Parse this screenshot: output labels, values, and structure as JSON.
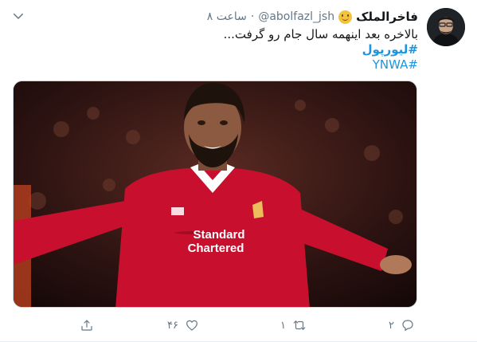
{
  "tweet": {
    "display_name": "فاخرالملک",
    "emoji_icon": "slightly-smiling-face-icon",
    "handle": "@abolfazl_jsh",
    "separator": "·",
    "time": "۸ ساعت",
    "text_line": "بالاخره بعد اینهمه سال جام رو گرفت...",
    "hashtag_1": "#لیورپول",
    "hashtag_2": "#YNWA",
    "media_text": {
      "sponsor_line_1": "Standard",
      "sponsor_line_2": "Chartered"
    }
  },
  "actions": {
    "reply_count": "۲",
    "retweet_count": "۱",
    "like_count": "۴۶",
    "reply_icon": "comment-bubble-icon",
    "retweet_icon": "retweet-icon",
    "like_icon": "heart-icon",
    "share_icon": "share-icon"
  },
  "colors": {
    "link": "#1b95e0",
    "muted": "#657786",
    "jersey": "#c8102e"
  }
}
